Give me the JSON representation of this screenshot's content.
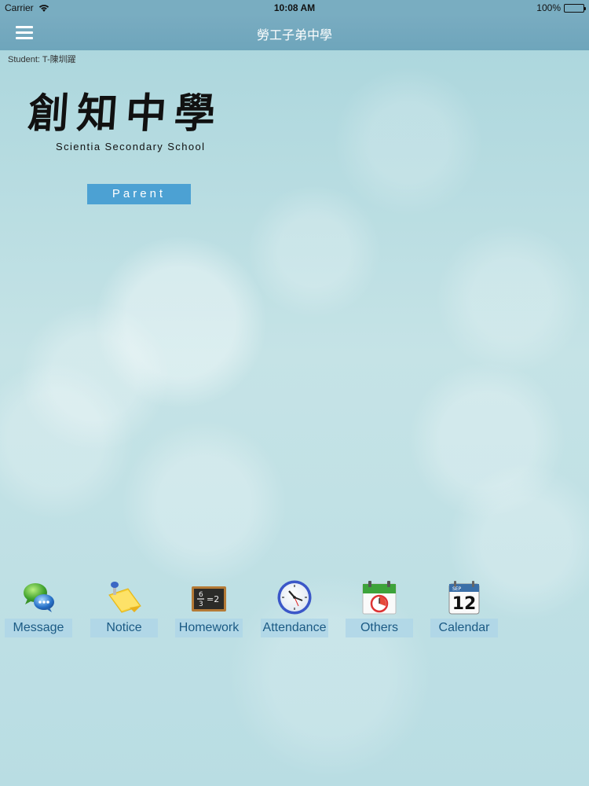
{
  "status_bar": {
    "carrier": "Carrier",
    "time": "10:08 AM",
    "battery": "100%",
    "battery_level": 1.0
  },
  "nav": {
    "title": "勞工子弟中學"
  },
  "student": {
    "label": "Student: T-陳圳躍"
  },
  "logo": {
    "chinese": "創知中學",
    "english": "Scientia Secondary School"
  },
  "role_button": {
    "label": "Parent"
  },
  "menu": {
    "items": [
      {
        "label": "Message",
        "icon": "chat-bubbles-icon"
      },
      {
        "label": "Notice",
        "icon": "sticky-note-icon"
      },
      {
        "label": "Homework",
        "icon": "chalkboard-icon"
      },
      {
        "label": "Attendance",
        "icon": "clock-icon"
      },
      {
        "label": "Others",
        "icon": "calendar-clock-icon"
      },
      {
        "label": "Calendar",
        "icon": "calendar-icon"
      }
    ],
    "calendar_month": "SEP",
    "calendar_day": "12",
    "homework_fraction_top": "6",
    "homework_fraction_bottom": "3",
    "homework_result": "=2"
  },
  "colors": {
    "nav_bar": "#79acc1",
    "role_button": "#4ca1d3",
    "menu_label_text": "#1b5a84"
  }
}
